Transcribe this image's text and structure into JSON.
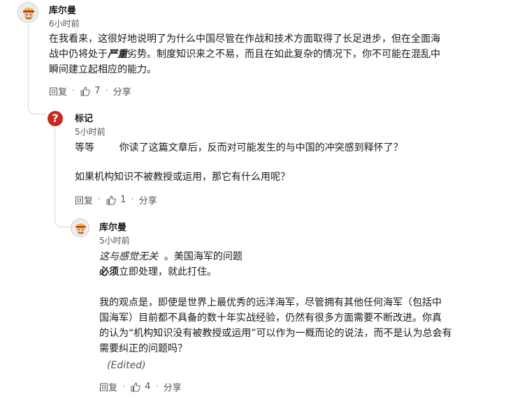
{
  "comments": [
    {
      "author": "库尔曼",
      "time": "6小时前",
      "body": {
        "line1": "在我看来，这很好地说明了为什么中国尽管在作战和技术方面取得了长足进步，但在全面海",
        "line2_a": "战中仍将处于",
        "line2_em": "严重",
        "line2_b": "劣势。制度知识来之不易，而且在如此复杂的情况下，你不可能在混乱中",
        "line3": "瞬间建立起相应的能力。"
      },
      "actions": {
        "reply": "回复",
        "likes": "7",
        "share": "分享"
      }
    },
    {
      "author": "标记",
      "time": "5小时前",
      "body": {
        "p1": "等等        你读了这篇文章后，反而对可能发生的与中国的冲突感到释怀了？",
        "p2": "如果机构知识不被教授或运用，那它有什么用呢？"
      },
      "actions": {
        "reply": "回复",
        "likes": "1",
        "share": "分享"
      }
    },
    {
      "author": "库尔曼",
      "time": "5小时前",
      "body": {
        "l1_em": "这与感觉无关",
        "l1_b": "  。美国海军的问题",
        "l2_bold": "必须",
        "l2_b": "立即处理，就此打住。",
        "p2_l1": "我的观点是，即使是世界上最优秀的远洋海军，尽管拥有其他任何海军（包括中",
        "p2_l2": "国海军）目前都不具备的数十年实战经验，仍然有很多方面需要不断改进。你真",
        "p2_l3": "的认为“机构知识没有被教授或运用”可以作为一概而论的说法，而不是认为总会有",
        "p2_l4": "需要纠正的问题吗？",
        "edited": "(Edited)"
      },
      "actions": {
        "reply": "回复",
        "likes": "4",
        "share": "分享"
      }
    }
  ]
}
